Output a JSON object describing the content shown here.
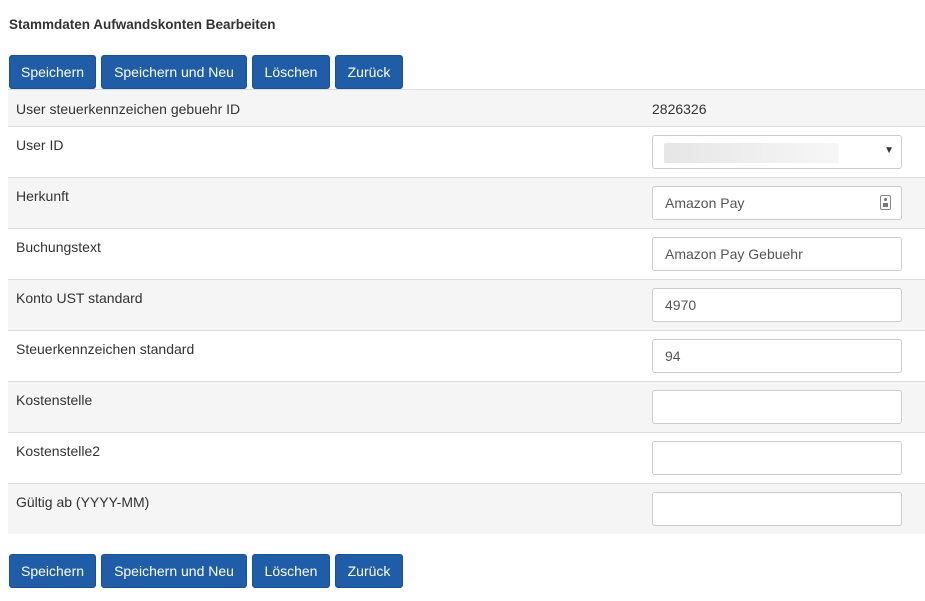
{
  "page": {
    "title": "Stammdaten Aufwandskonten Bearbeiten"
  },
  "toolbar": {
    "save_label": "Speichern",
    "save_new_label": "Speichern und Neu",
    "delete_label": "Löschen",
    "back_label": "Zurück"
  },
  "form": {
    "id_label": "User steuerkennzeichen gebuehr ID",
    "id_value": "2826326",
    "user_id_label": "User ID",
    "user_id_value": "",
    "herkunft_label": "Herkunft",
    "herkunft_value": "Amazon Pay",
    "buchungstext_label": "Buchungstext",
    "buchungstext_value": "Amazon Pay Gebuehr",
    "konto_ust_label": "Konto UST standard",
    "konto_ust_value": "4970",
    "steuerkennzeichen_label": "Steuerkennzeichen standard",
    "steuerkennzeichen_value": "94",
    "kostenstelle_label": "Kostenstelle",
    "kostenstelle_value": "",
    "kostenstelle2_label": "Kostenstelle2",
    "kostenstelle2_value": "",
    "gueltig_ab_label": "Gültig ab (YYYY-MM)",
    "gueltig_ab_value": ""
  },
  "icons": {
    "select_caret": "caret-down-icon",
    "autofill": "contact-card-icon"
  },
  "colors": {
    "button_bg": "#1f5da8",
    "row_alt_bg": "#f5f5f5",
    "border": "#dddddd"
  }
}
